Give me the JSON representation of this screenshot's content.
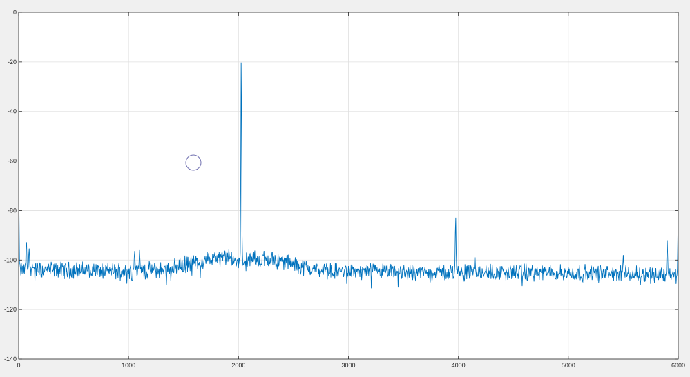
{
  "chart_data": {
    "type": "line",
    "title": "",
    "xlabel": "",
    "ylabel": "",
    "xlim": [
      0,
      6000
    ],
    "ylim": [
      -140,
      0
    ],
    "grid": true,
    "xticks": [
      "0",
      "1000",
      "2000",
      "3000",
      "4000",
      "5000",
      "6000"
    ],
    "yticks": [
      "0",
      "-20",
      "-40",
      "-60",
      "-80",
      "-100",
      "-120",
      "-140"
    ],
    "noise_floor": [
      {
        "x": 0,
        "y": -104
      },
      {
        "x": 500,
        "y": -104
      },
      {
        "x": 1000,
        "y": -104.5
      },
      {
        "x": 1300,
        "y": -104
      },
      {
        "x": 1500,
        "y": -102
      },
      {
        "x": 1700,
        "y": -100
      },
      {
        "x": 1900,
        "y": -99
      },
      {
        "x": 2000,
        "y": -100.5
      },
      {
        "x": 2200,
        "y": -99.5
      },
      {
        "x": 2400,
        "y": -100.5
      },
      {
        "x": 2600,
        "y": -103
      },
      {
        "x": 2800,
        "y": -104.5
      },
      {
        "x": 3500,
        "y": -105
      },
      {
        "x": 4500,
        "y": -105
      },
      {
        "x": 5500,
        "y": -105.5
      },
      {
        "x": 6000,
        "y": -106
      }
    ],
    "peaks": [
      {
        "x": 0,
        "y": -66
      },
      {
        "x": 70,
        "y": -91
      },
      {
        "x": 95,
        "y": -95
      },
      {
        "x": 1055,
        "y": -96
      },
      {
        "x": 1100,
        "y": -96
      },
      {
        "x": 2025,
        "y": -17
      },
      {
        "x": 3975,
        "y": -82
      },
      {
        "x": 4150,
        "y": -98
      },
      {
        "x": 5500,
        "y": -98
      },
      {
        "x": 5900,
        "y": -92
      },
      {
        "x": 6000,
        "y": -79
      }
    ],
    "colors": {
      "line": "#0072bd",
      "axes_bg": "#ffffff",
      "grid": "#dfdfdf",
      "figure_bg": "#f0f0f0",
      "marker": "#7070b0"
    }
  }
}
